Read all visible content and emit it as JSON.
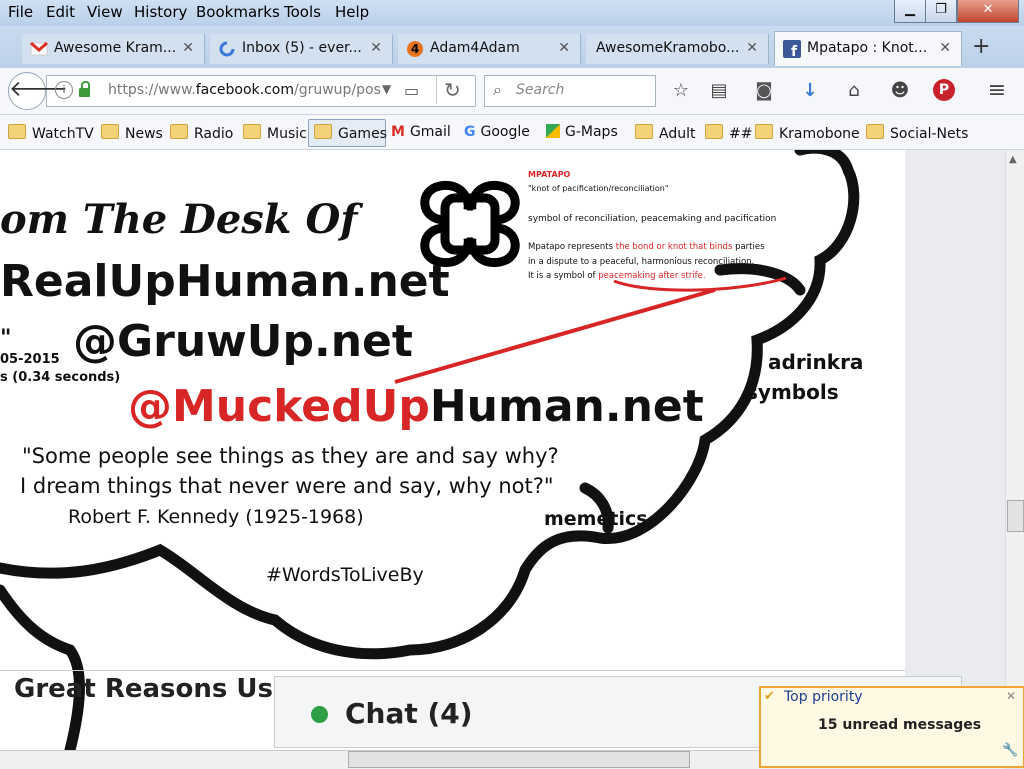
{
  "menu": [
    "File",
    "Edit",
    "View",
    "History",
    "Bookmarks",
    "Tools",
    "Help"
  ],
  "tabs": [
    {
      "label": "Awesome Kram...",
      "icon": "gmail-icon"
    },
    {
      "label": "Inbox (5) - ever...",
      "icon": "loading-icon"
    },
    {
      "label": "Adam4Adam",
      "icon": "adam4adam-icon"
    },
    {
      "label": "AwesomeKramobo...",
      "icon": ""
    },
    {
      "label": "Mpatapo : Knot...",
      "icon": "facebook-icon",
      "active": true
    }
  ],
  "url": {
    "prefix": "https://www.",
    "host": "facebook.com",
    "path": "/gruwup/pos"
  },
  "search": {
    "placeholder": "Search"
  },
  "bookmarks": [
    "WatchTV",
    "News",
    "Radio",
    "Music",
    "Games",
    "Gmail",
    "Google",
    "G-Maps",
    "Adult",
    "##",
    "Kramobone",
    "Social-Nets"
  ],
  "post": {
    "desk": "om The Desk Of",
    "site1": "RealUpHuman.net",
    "site2": "@GruwUp.net",
    "site3_red": "@MuckedUp",
    "site3_black": "Human.net",
    "quote_mark": "\"",
    "date": "05-2015",
    "seconds": "s (0.34 seconds)",
    "quote1": "\"Some people see things as they are and say why?",
    "quote2": "I dream things that never were and say, why not?\"",
    "author": "Robert F. Kennedy (1925-1968)",
    "hashtag": "#WordsToLiveBy",
    "adrinkra1": "adrinkra",
    "adrinkra2": "symbols",
    "memetics": "memetics",
    "mp_title": "MPATAPO",
    "mp_sub": "\"knot of pacification/reconciliation\"",
    "mp_sym": "symbol of reconciliation, peacemaking and pacification",
    "mp_l1a": "Mpatapo represents ",
    "mp_l1b": "the bond or knot that binds",
    "mp_l1c": " parties",
    "mp_l2": "in a dispute to a peaceful, harmonious reconciliation.",
    "mp_l3a": "It is a symbol of ",
    "mp_l3b": "peacemaking after strife.",
    "bottom": "Great Reasons Us"
  },
  "chat": {
    "label": "Chat (4)"
  },
  "priority": {
    "title": "Top priority",
    "message": "15 unread messages"
  },
  "colors": {
    "accent_red": "#d32222",
    "chat_green": "#2e9e47",
    "priority_border": "#f0a534"
  }
}
